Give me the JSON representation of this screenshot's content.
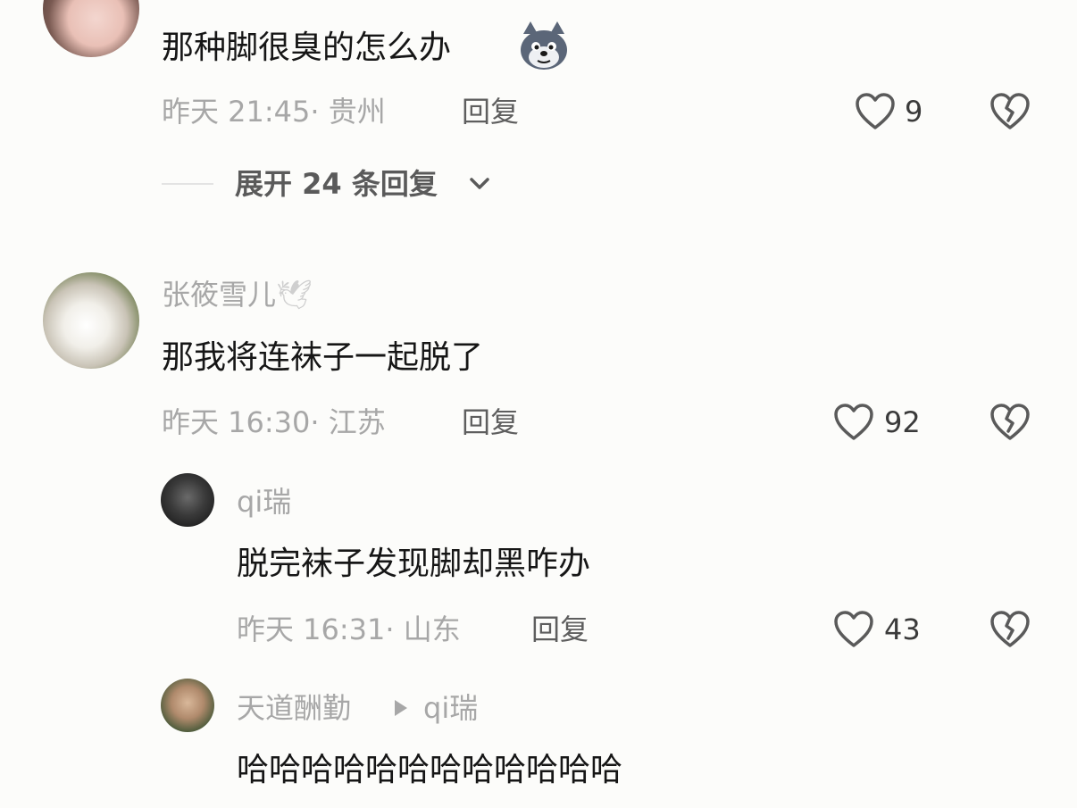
{
  "comments": [
    {
      "text": "那种脚很臭的怎么办",
      "emoji": "wolf-face",
      "time": "昨天 21:45",
      "location": "贵州",
      "reply": "回复",
      "likes": "9",
      "expand": "展开 24 条回复"
    },
    {
      "username": "张筱雪儿",
      "username_emoji": "🕊",
      "text": "那我将连袜子一起脱了",
      "time": "昨天 16:30",
      "location": "江苏",
      "reply": "回复",
      "likes": "92"
    }
  ],
  "replies": [
    {
      "username": "qi瑞",
      "text": "脱完袜子发现脚却黑咋办",
      "time": "昨天 16:31",
      "location": "山东",
      "reply": "回复",
      "likes": "43"
    },
    {
      "username": "天道酬勤",
      "reply_to": "qi瑞",
      "text": "哈哈哈哈哈哈哈哈哈哈哈哈"
    }
  ],
  "colors": {
    "background": "#fcfcfa",
    "text": "#161616",
    "meta": "#a7a7a7",
    "icon": "#5a5a5a"
  }
}
